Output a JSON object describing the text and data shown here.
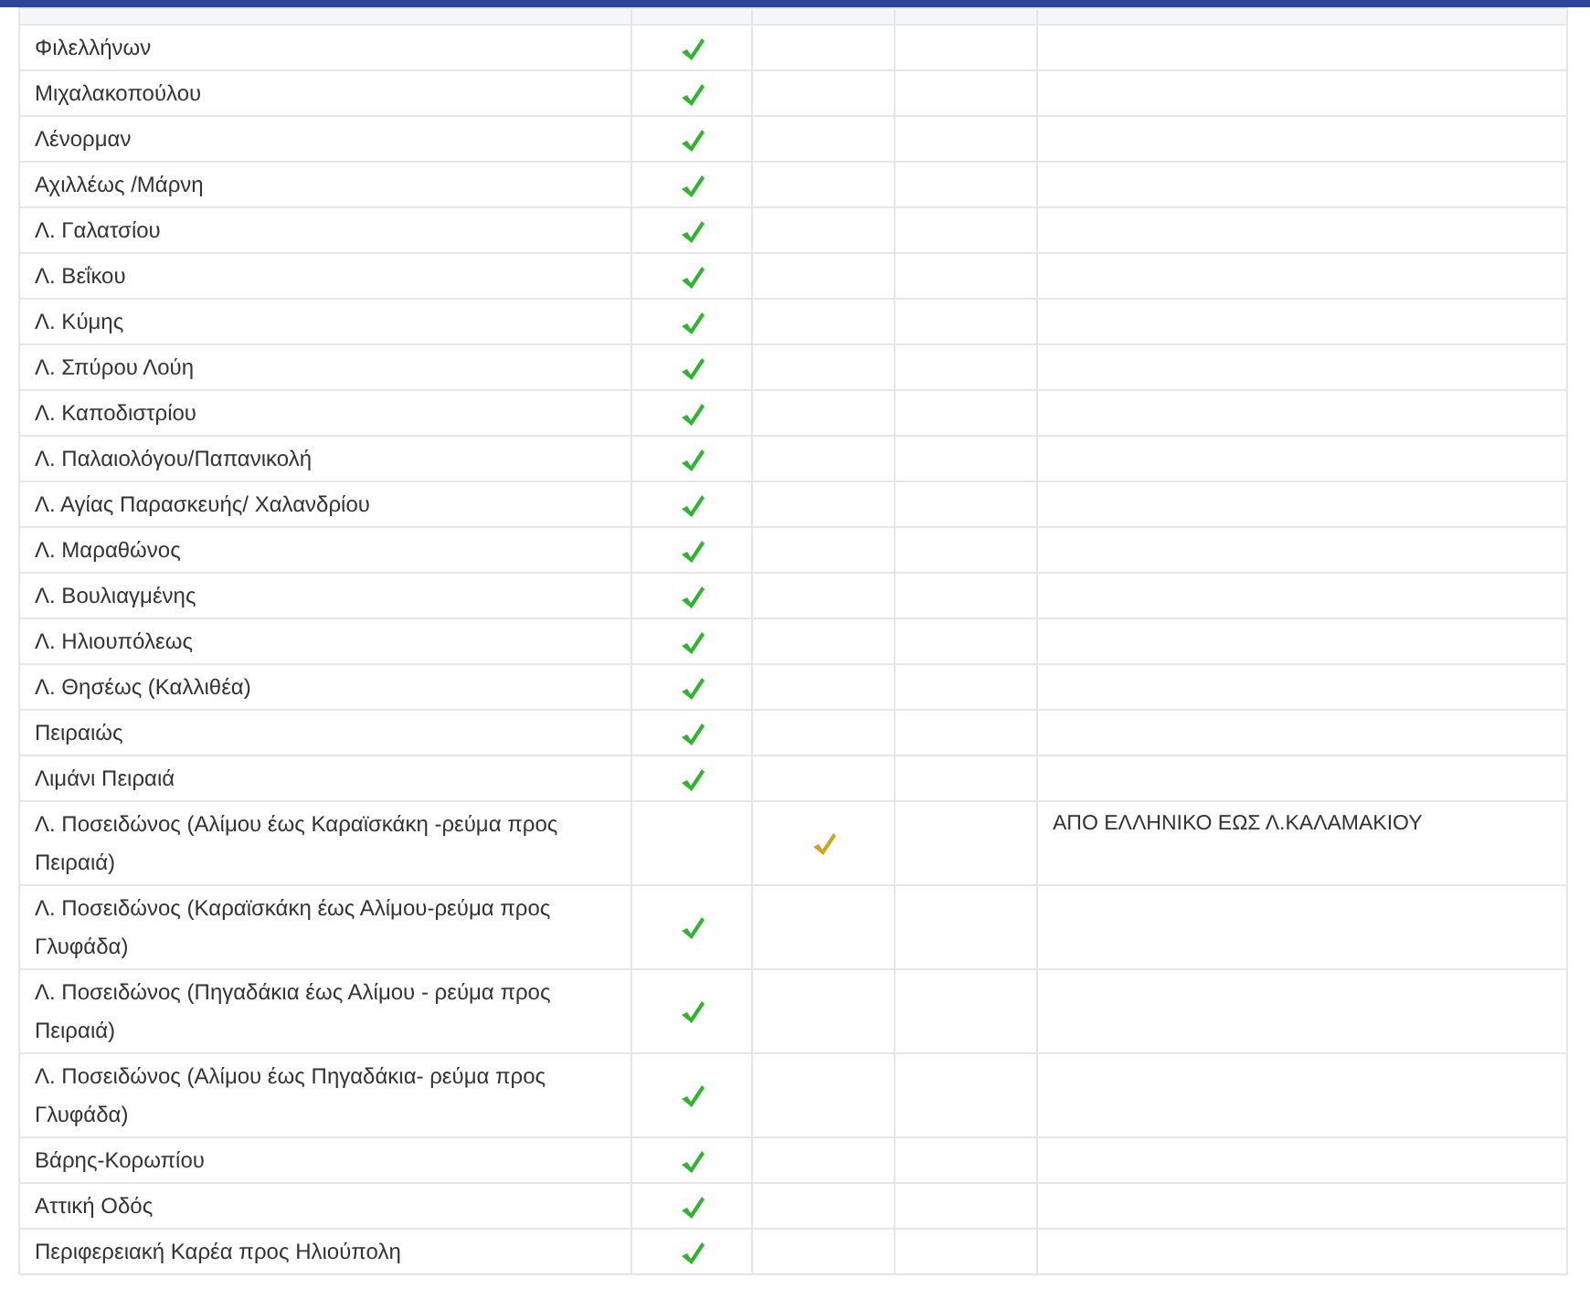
{
  "rows": [
    {
      "name": "Φιλελλήνων",
      "full": true,
      "partial": false
    },
    {
      "name": "Μιχαλακοπούλου",
      "full": true,
      "partial": false
    },
    {
      "name": "Λένορμαν",
      "full": true,
      "partial": false
    },
    {
      "name": "Αχιλλέως /Μάρνη",
      "full": true,
      "partial": false
    },
    {
      "name": "Λ. Γαλατσίου",
      "full": true,
      "partial": false
    },
    {
      "name": "Λ. Βεΐκου",
      "full": true,
      "partial": false
    },
    {
      "name": "Λ. Κύμης",
      "full": true,
      "partial": false
    },
    {
      "name": "Λ. Σπύρου Λούη",
      "full": true,
      "partial": false
    },
    {
      "name": "Λ. Καποδιστρίου",
      "full": true,
      "partial": false
    },
    {
      "name": "Λ. Παλαιολόγου/Παπανικολή",
      "full": true,
      "partial": false
    },
    {
      "name": "Λ. Αγίας Παρασκευής/ Χαλανδρίου",
      "full": true,
      "partial": false
    },
    {
      "name": "Λ. Μαραθώνος",
      "full": true,
      "partial": false
    },
    {
      "name": "Λ. Βουλιαγμένης",
      "full": true,
      "partial": false
    },
    {
      "name": "Λ. Ηλιουπόλεως",
      "full": true,
      "partial": false
    },
    {
      "name": "Λ. Θησέως (Καλλιθέα)",
      "full": true,
      "partial": false
    },
    {
      "name": "Πειραιώς",
      "full": true,
      "partial": false
    },
    {
      "name": "Λιμάνι Πειραιά",
      "full": true,
      "partial": false
    },
    {
      "name": "Λ. Ποσειδώνος (Αλίμου έως Καραϊσκάκη -ρεύμα προς Πειραιά)",
      "full": false,
      "partial": true,
      "note": "ΑΠΟ ΕΛΛΗΝΙΚΟ ΕΩΣ Λ.ΚΑΛΑΜΑΚΙΟΥ"
    },
    {
      "name": "Λ. Ποσειδώνος (Καραϊσκάκη έως Αλίμου-ρεύμα προς Γλυφάδα)",
      "full": true,
      "partial": false
    },
    {
      "name": "Λ. Ποσειδώνος (Πηγαδάκια έως Αλίμου - ρεύμα προς Πειραιά)",
      "full": true,
      "partial": false
    },
    {
      "name": "Λ. Ποσειδώνος (Αλίμου έως Πηγαδάκια- ρεύμα προς Γλυφάδα)",
      "full": true,
      "partial": false
    },
    {
      "name": "Βάρης-Κορωπίου",
      "full": true,
      "partial": false
    },
    {
      "name": "Αττική Οδός",
      "full": true,
      "partial": false
    },
    {
      "name": "Περιφερειακή Καρέα προς Ηλιούπολη",
      "full": true,
      "partial": false
    }
  ]
}
